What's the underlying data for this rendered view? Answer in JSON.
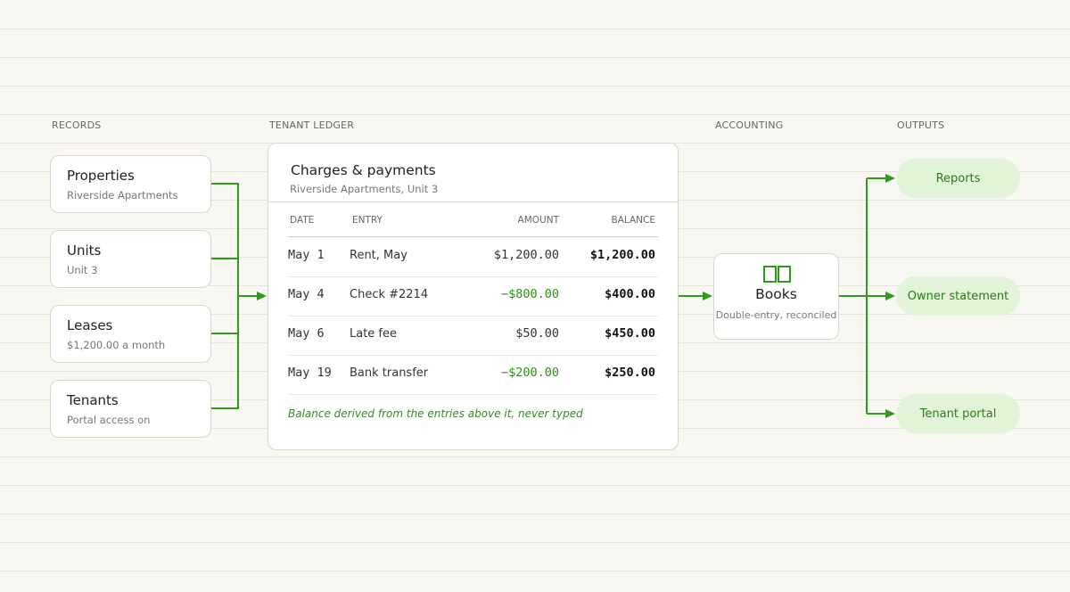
{
  "sections": {
    "records": "RECORDS",
    "tenant_ledger": "TENANT LEDGER",
    "accounting": "ACCOUNTING",
    "outputs": "OUTPUTS"
  },
  "records": [
    {
      "title": "Properties",
      "subtitle": "Riverside Apartments"
    },
    {
      "title": "Units",
      "subtitle": "Unit 3"
    },
    {
      "title": "Leases",
      "subtitle": "$1,200.00 a month"
    },
    {
      "title": "Tenants",
      "subtitle": "Portal access on"
    }
  ],
  "ledger": {
    "title": "Charges & payments",
    "subtitle": "Riverside Apartments, Unit 3",
    "headers": {
      "date": "DATE",
      "entry": "ENTRY",
      "amount": "AMOUNT",
      "balance": "BALANCE"
    },
    "rows": [
      {
        "date": "May 1",
        "entry": "Rent, May",
        "amount": "$1,200.00",
        "balance": "$1,200.00"
      },
      {
        "date": "May 4",
        "entry": "Check #2214",
        "amount": "−$800.00",
        "balance": "$400.00"
      },
      {
        "date": "May 6",
        "entry": "Late fee",
        "amount": "$50.00",
        "balance": "$450.00"
      },
      {
        "date": "May 19",
        "entry": "Bank transfer",
        "amount": "−$200.00",
        "balance": "$250.00"
      }
    ],
    "note": "Balance derived from the entries above it, never typed"
  },
  "books": {
    "icon": "book-icon",
    "title": "Books",
    "subtitle": "Double-entry, reconciled"
  },
  "outputs": [
    {
      "label": "Reports"
    },
    {
      "label": "Owner statement"
    },
    {
      "label": "Tenant portal"
    }
  ],
  "colors": {
    "accent": "#2f9a1c",
    "pill_bg": "#e2f4d8",
    "pill_text": "#2b7a17",
    "negative": "#2f8d1e",
    "background": "#f8f7f2"
  }
}
